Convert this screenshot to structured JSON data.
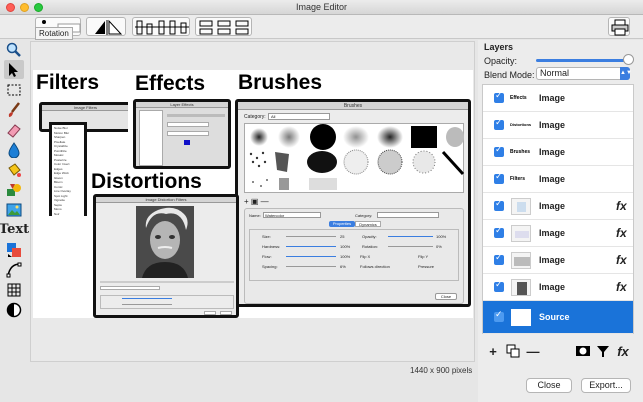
{
  "window": {
    "title": "Image Editor"
  },
  "toolbar": {
    "tooltip": "Rotation"
  },
  "tools": {
    "text_label": "Text"
  },
  "canvas": {
    "labels": {
      "filters": "Filters",
      "effects": "Effects",
      "brushes": "Brushes",
      "distortions": "Distortions"
    },
    "brushes_window": {
      "title": "Brushes",
      "category_label": "Category:",
      "category_value": "All",
      "name_label": "Name:",
      "name_value": "Watercolor",
      "category2_label": "Category:",
      "tab_properties": "Properties",
      "tab_dynamics": "Dynamics",
      "size_label": "Size:",
      "size_value": "25",
      "hardness_label": "Hardness:",
      "hardness_value": "100%",
      "flow_label": "Flow:",
      "flow_value": "100%",
      "spacing_label": "Spacing:",
      "spacing_value": "6%",
      "opacity_label": "Opacity:",
      "opacity_value": "100%",
      "rotation_label": "Rotation:",
      "rotation_value": "0%",
      "flipx": "Flip X",
      "flipy": "Flip Y",
      "follows": "Follows direction",
      "pressure": "Pressure",
      "close": "Close"
    },
    "filters_window": {
      "title": "Image Filters"
    },
    "effects_window": {
      "title": "Layer Effects"
    },
    "distortions_window": {
      "title": "Image Distortion Filters"
    },
    "status": "1440 x 900 pixels"
  },
  "layers": {
    "heading": "Layers",
    "opacity_label": "Opacity:",
    "opacity_value": 1.0,
    "blend_label": "Blend Mode:",
    "blend_value": "Normal",
    "items": [
      {
        "name": "Image",
        "thumb": "Effects",
        "fx": false,
        "selected": false
      },
      {
        "name": "Image",
        "thumb": "Distortions",
        "fx": false,
        "selected": false
      },
      {
        "name": "Image",
        "thumb": "Brushes",
        "fx": false,
        "selected": false
      },
      {
        "name": "Image",
        "thumb": "Filters",
        "fx": false,
        "selected": false
      },
      {
        "name": "Image",
        "thumb": "",
        "fx": true,
        "selected": false
      },
      {
        "name": "Image",
        "thumb": "",
        "fx": true,
        "selected": false
      },
      {
        "name": "Image",
        "thumb": "",
        "fx": true,
        "selected": false
      },
      {
        "name": "Image",
        "thumb": "",
        "fx": true,
        "selected": false
      },
      {
        "name": "Source",
        "thumb": "",
        "fx": false,
        "selected": true
      }
    ],
    "fx_label": "fx"
  },
  "footer": {
    "close": "Close",
    "export": "Export..."
  },
  "colors": {
    "accent": "#1a73d9",
    "window_bg": "#ececec"
  }
}
